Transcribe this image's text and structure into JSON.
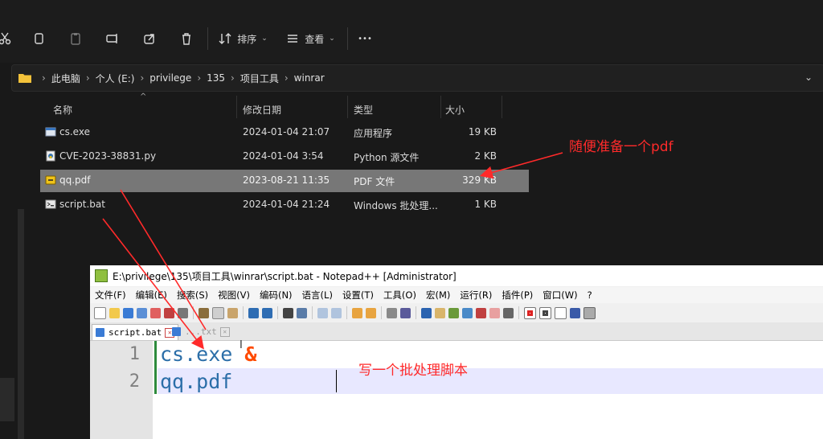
{
  "toolbar": {
    "sort_label": "排序",
    "view_label": "查看",
    "more_label": "•••"
  },
  "address": {
    "crumbs": [
      "此电脑",
      "个人 (E:)",
      "privilege",
      "135",
      "项目工具",
      "winrar"
    ]
  },
  "columns": {
    "name": "名称",
    "date": "修改日期",
    "type": "类型",
    "size": "大小"
  },
  "files": [
    {
      "name": "cs.exe",
      "date": "2024-01-04 21:07",
      "type": "应用程序",
      "size": "19 KB",
      "icon": "exe-icon"
    },
    {
      "name": "CVE-2023-38831.py",
      "date": "2024-01-04 3:54",
      "type": "Python 源文件",
      "size": "2 KB",
      "icon": "python-file-icon"
    },
    {
      "name": "qq.pdf",
      "date": "2023-08-21 11:35",
      "type": "PDF 文件",
      "size": "329 KB",
      "icon": "pdf-file-icon",
      "selected": true
    },
    {
      "name": "script.bat",
      "date": "2024-01-04 21:24",
      "type": "Windows 批处理...",
      "size": "1 KB",
      "icon": "batch-file-icon"
    }
  ],
  "annotations": {
    "pdf_note": "随便准备一个pdf",
    "script_note": "写一个批处理脚本",
    "color": "#ff2a2a"
  },
  "notepad": {
    "title": "E:\\privilege\\135\\项目工具\\winrar\\script.bat - Notepad++ [Administrator]",
    "menu": [
      "文件(F)",
      "编辑(E)",
      "搜索(S)",
      "视图(V)",
      "编码(N)",
      "语言(L)",
      "设置(T)",
      "工具(O)",
      "宏(M)",
      "运行(R)",
      "插件(P)",
      "窗口(W)",
      "?"
    ],
    "tabs": [
      {
        "label": "script.bat",
        "active": true
      },
      {
        "label": "...txt",
        "active": false
      }
    ],
    "lines": [
      {
        "num": "1",
        "text": "cs.exe ",
        "amp": "&"
      },
      {
        "num": "2",
        "text": "qq.pdf",
        "amp": ""
      }
    ]
  }
}
